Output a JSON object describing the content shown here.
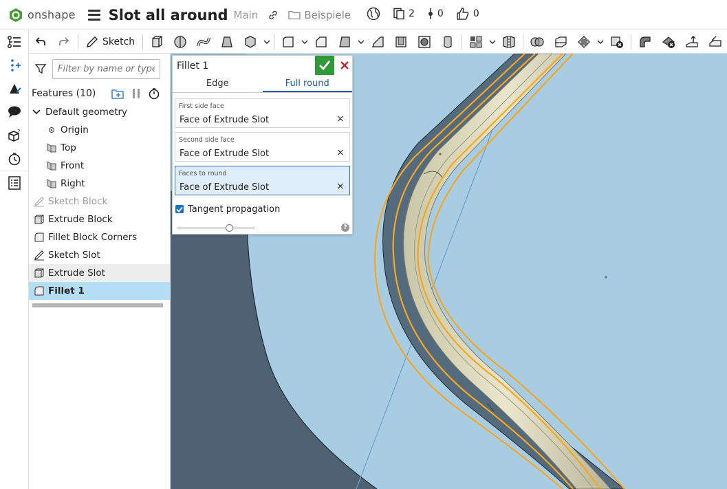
{
  "app": {
    "brand": "onshape",
    "accent": "#4a9b3c"
  },
  "document": {
    "title": "Slot all around",
    "branch": "Main",
    "folder": "Beispiele"
  },
  "header": {
    "versions_count": "2",
    "branches_count": "0",
    "likes_count": "0"
  },
  "toolbar": {
    "sketch_label": "Sketch"
  },
  "feature_panel": {
    "filter_placeholder": "Filter by name or type",
    "features_title": "Features (10)",
    "default_geometry_label": "Default geometry",
    "items": [
      {
        "label": "Origin",
        "icon": "origin-icon",
        "state": "normal"
      },
      {
        "label": "Top",
        "icon": "plane-icon",
        "state": "normal"
      },
      {
        "label": "Front",
        "icon": "plane-icon",
        "state": "normal"
      },
      {
        "label": "Right",
        "icon": "plane-icon",
        "state": "normal"
      },
      {
        "label": "Sketch Block",
        "icon": "sketch-icon",
        "state": "dim"
      },
      {
        "label": "Extrude Block",
        "icon": "extrude-icon",
        "state": "normal"
      },
      {
        "label": "Fillet Block Corners",
        "icon": "fillet-icon",
        "state": "normal"
      },
      {
        "label": "Sketch Slot",
        "icon": "sketch-icon",
        "state": "normal"
      },
      {
        "label": "Extrude Slot",
        "icon": "extrude-icon",
        "state": "hover"
      },
      {
        "label": "Fillet 1",
        "icon": "fillet-icon",
        "state": "selected"
      }
    ]
  },
  "fillet_dialog": {
    "title": "Fillet 1",
    "tabs": [
      "Edge",
      "Full round"
    ],
    "active_tab": "Full round",
    "fields": [
      {
        "label": "First side face",
        "value": "Face of Extrude Slot",
        "active": false
      },
      {
        "label": "Second side face",
        "value": "Face of Extrude Slot",
        "active": false
      },
      {
        "label": "Faces to round",
        "value": "Face of Extrude Slot",
        "active": true
      }
    ],
    "tangent_label": "Tangent propagation",
    "tangent_checked": true,
    "ok_color": "#2f9a37",
    "cancel_color": "#c62828"
  },
  "viewport": {
    "background": "#9fc3dc",
    "highlight": "#f5a623"
  }
}
